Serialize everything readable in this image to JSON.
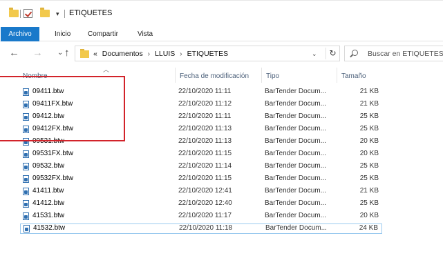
{
  "window": {
    "title": "ETIQUETES"
  },
  "ribbon": {
    "file_tab": "Archivo",
    "tabs": [
      "Inicio",
      "Compartir",
      "Vista"
    ]
  },
  "address": {
    "overflow": "«",
    "crumbs": [
      "Documentos",
      "LLUIS",
      "ETIQUETES"
    ],
    "separator": "›"
  },
  "search": {
    "placeholder": "Buscar en ETIQUETES"
  },
  "columns": {
    "name": "Nombre",
    "date": "Fecha de modificación",
    "type": "Tipo",
    "size": "Tamaño"
  },
  "files": [
    {
      "name": "09411.btw",
      "date": "22/10/2020 11:11",
      "type": "BarTender Docum...",
      "size": "21 KB"
    },
    {
      "name": "09411FX.btw",
      "date": "22/10/2020 11:12",
      "type": "BarTender Docum...",
      "size": "21 KB"
    },
    {
      "name": "09412.btw",
      "date": "22/10/2020 11:11",
      "type": "BarTender Docum...",
      "size": "25 KB"
    },
    {
      "name": "09412FX.btw",
      "date": "22/10/2020 11:13",
      "type": "BarTender Docum...",
      "size": "25 KB"
    },
    {
      "name": "09531.btw",
      "date": "22/10/2020 11:13",
      "type": "BarTender Docum...",
      "size": "20 KB"
    },
    {
      "name": "09531FX.btw",
      "date": "22/10/2020 11:15",
      "type": "BarTender Docum...",
      "size": "20 KB"
    },
    {
      "name": "09532.btw",
      "date": "22/10/2020 11:14",
      "type": "BarTender Docum...",
      "size": "25 KB"
    },
    {
      "name": "09532FX.btw",
      "date": "22/10/2020 11:15",
      "type": "BarTender Docum...",
      "size": "25 KB"
    },
    {
      "name": "41411.btw",
      "date": "22/10/2020 12:41",
      "type": "BarTender Docum...",
      "size": "21 KB"
    },
    {
      "name": "41412.btw",
      "date": "22/10/2020 12:40",
      "type": "BarTender Docum...",
      "size": "25 KB"
    },
    {
      "name": "41531.btw",
      "date": "22/10/2020 11:17",
      "type": "BarTender Docum...",
      "size": "20 KB"
    },
    {
      "name": "41532.btw",
      "date": "22/10/2020 11:18",
      "type": "BarTender Docum...",
      "size": "24 KB"
    }
  ],
  "colors": {
    "accent": "#1979ca",
    "highlight": "#d2232a",
    "header_text": "#4c607a",
    "folder": "#f2c94c"
  }
}
